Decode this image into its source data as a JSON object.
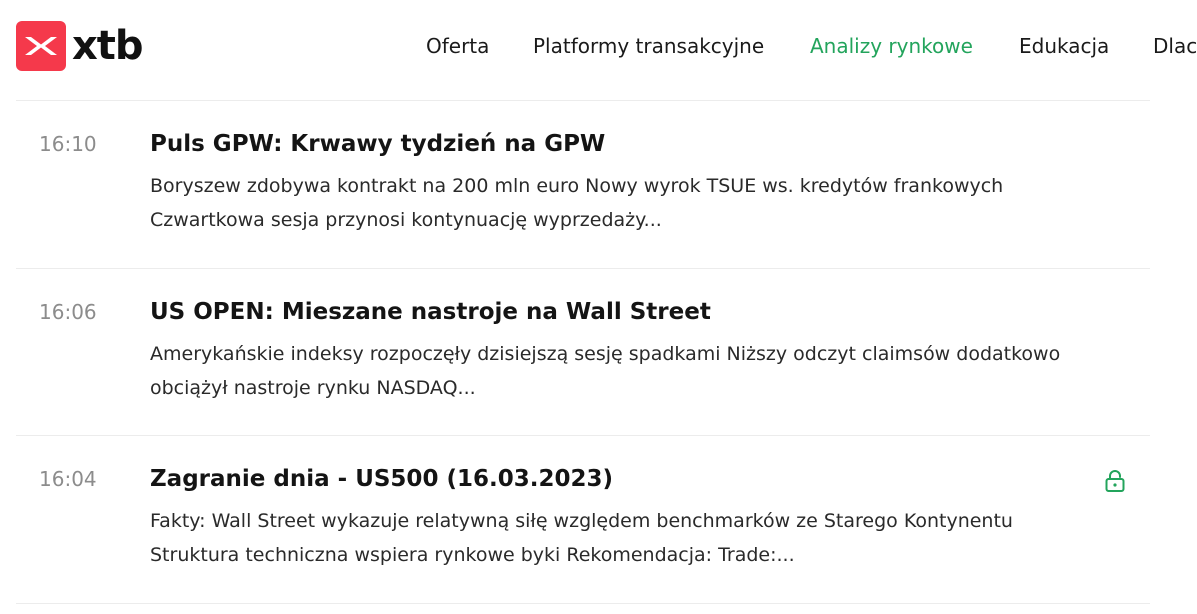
{
  "brand": {
    "name": "xtb",
    "accent_color": "#f5394b",
    "active_color": "#23a45c"
  },
  "nav": {
    "items": [
      {
        "label": "Oferta",
        "active": false
      },
      {
        "label": "Platformy transakcyjne",
        "active": false
      },
      {
        "label": "Analizy rynkowe",
        "active": true
      },
      {
        "label": "Edukacja",
        "active": false
      },
      {
        "label": "Dlac",
        "active": false
      }
    ]
  },
  "news": [
    {
      "time": "16:10",
      "title": "Puls GPW: Krwawy tydzień na GPW",
      "desc_line1": "Boryszew zdobywa kontrakt na 200 mln euro Nowy wyrok TSUE ws. kredytów frankowych",
      "desc_line2": "Czwartkowa sesja przynosi kontynuację wyprzedaży...",
      "locked": false
    },
    {
      "time": "16:06",
      "title": "US OPEN: Mieszane nastroje na Wall Street",
      "desc_line1": "Amerykańskie indeksy rozpoczęły dzisiejszą sesję spadkami Niższy odczyt claimsów dodatkowo",
      "desc_line2": "obciążył nastroje rynku NASDAQ...",
      "locked": false
    },
    {
      "time": "16:04",
      "title": "Zagranie dnia - US500 (16.03.2023)",
      "desc_line1": "Fakty:  Wall Street wykazuje relatywną siłę względem benchmarków ze Starego Kontynentu",
      "desc_line2": "Struktura techniczna wspiera rynkowe byki  Rekomendacja: Trade:...",
      "locked": true,
      "lock_icon": "lock-icon"
    }
  ]
}
